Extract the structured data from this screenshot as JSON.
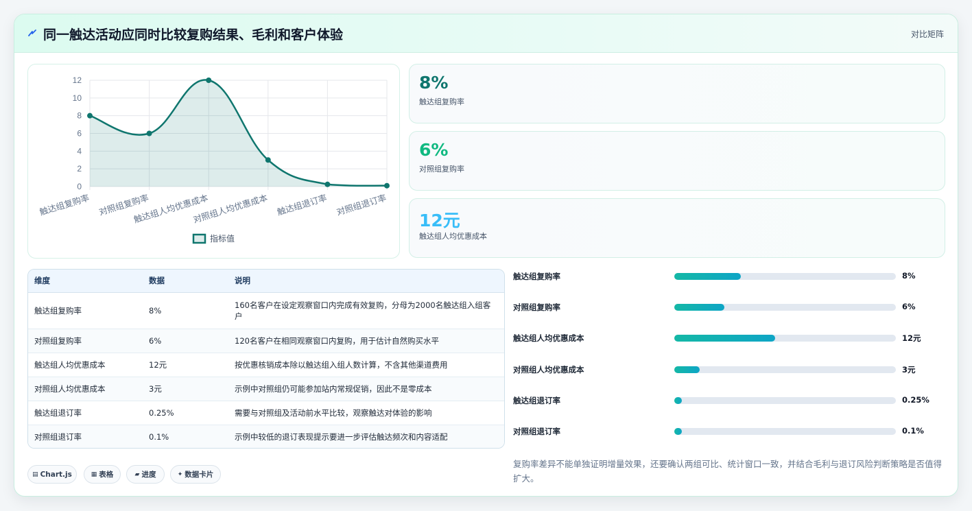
{
  "header": {
    "title": "同一触达活动应同时比较复购结果、毛利和客户体验",
    "link": "对比矩阵",
    "icon": "lightning-icon"
  },
  "chart_data": {
    "type": "line",
    "categories": [
      "触达组复购率",
      "对照组复购率",
      "触达组人均优惠成本",
      "对照组人均优惠成本",
      "触达组退订率",
      "对照组退订率"
    ],
    "series": [
      {
        "name": "指标值",
        "values": [
          8,
          6,
          12,
          3,
          0.25,
          0.1
        ]
      }
    ],
    "ylim": [
      0,
      12
    ],
    "yticks": [
      "0",
      "2",
      "4",
      "6",
      "8",
      "10",
      "12"
    ],
    "grid": true,
    "legend": "bottom",
    "color": "#0f766e"
  },
  "kpis": [
    {
      "value": "8%",
      "label": "触达组复购率",
      "color": "#0f766e"
    },
    {
      "value": "6%",
      "label": "对照组复购率",
      "color": "#10b981"
    },
    {
      "value": "12元",
      "label": "触达组人均优惠成本",
      "color": "#38bdf8"
    }
  ],
  "table": {
    "headers": [
      "维度",
      "数据",
      "说明"
    ],
    "rows": [
      [
        "触达组复购率",
        "8%",
        "160名客户在设定观察窗口内完成有效复购，分母为2000名触达组入组客户"
      ],
      [
        "对照组复购率",
        "6%",
        "120名客户在相同观察窗口内复购，用于估计自然购买水平"
      ],
      [
        "触达组人均优惠成本",
        "12元",
        "按优惠核销成本除以触达组入组人数计算，不含其他渠道费用"
      ],
      [
        "对照组人均优惠成本",
        "3元",
        "示例中对照组仍可能参加站内常规促销，因此不是零成本"
      ],
      [
        "触达组退订率",
        "0.25%",
        "需要与对照组及活动前水平比较，观察触达对体验的影响"
      ],
      [
        "对照组退订率",
        "0.1%",
        "示例中较低的退订表现提示要进一步评估触达频次和内容适配"
      ]
    ]
  },
  "progress": [
    {
      "label": "触达组复购率",
      "value": "8%",
      "fraction": 0.3
    },
    {
      "label": "对照组复购率",
      "value": "6%",
      "fraction": 0.225
    },
    {
      "label": "触达组人均优惠成本",
      "value": "12元",
      "fraction": 0.455
    },
    {
      "label": "对照组人均优惠成本",
      "value": "3元",
      "fraction": 0.115
    },
    {
      "label": "触达组退订率",
      "value": "0.25%",
      "fraction": 0.035
    },
    {
      "label": "对照组退订率",
      "value": "0.1%",
      "fraction": 0.035
    }
  ],
  "chips": [
    {
      "icon": "chart-icon",
      "glyph": "▤",
      "label": "Chart.js"
    },
    {
      "icon": "table-icon",
      "glyph": "▦",
      "label": "表格"
    },
    {
      "icon": "progress-icon",
      "glyph": "▰",
      "label": "进度"
    },
    {
      "icon": "sparkle-icon",
      "glyph": "✦",
      "label": "数据卡片"
    }
  ],
  "note": "复购率差异不能单独证明增量效果，还要确认两组可比、统计窗口一致，并结合毛利与退订风险判断策略是否值得扩大。"
}
